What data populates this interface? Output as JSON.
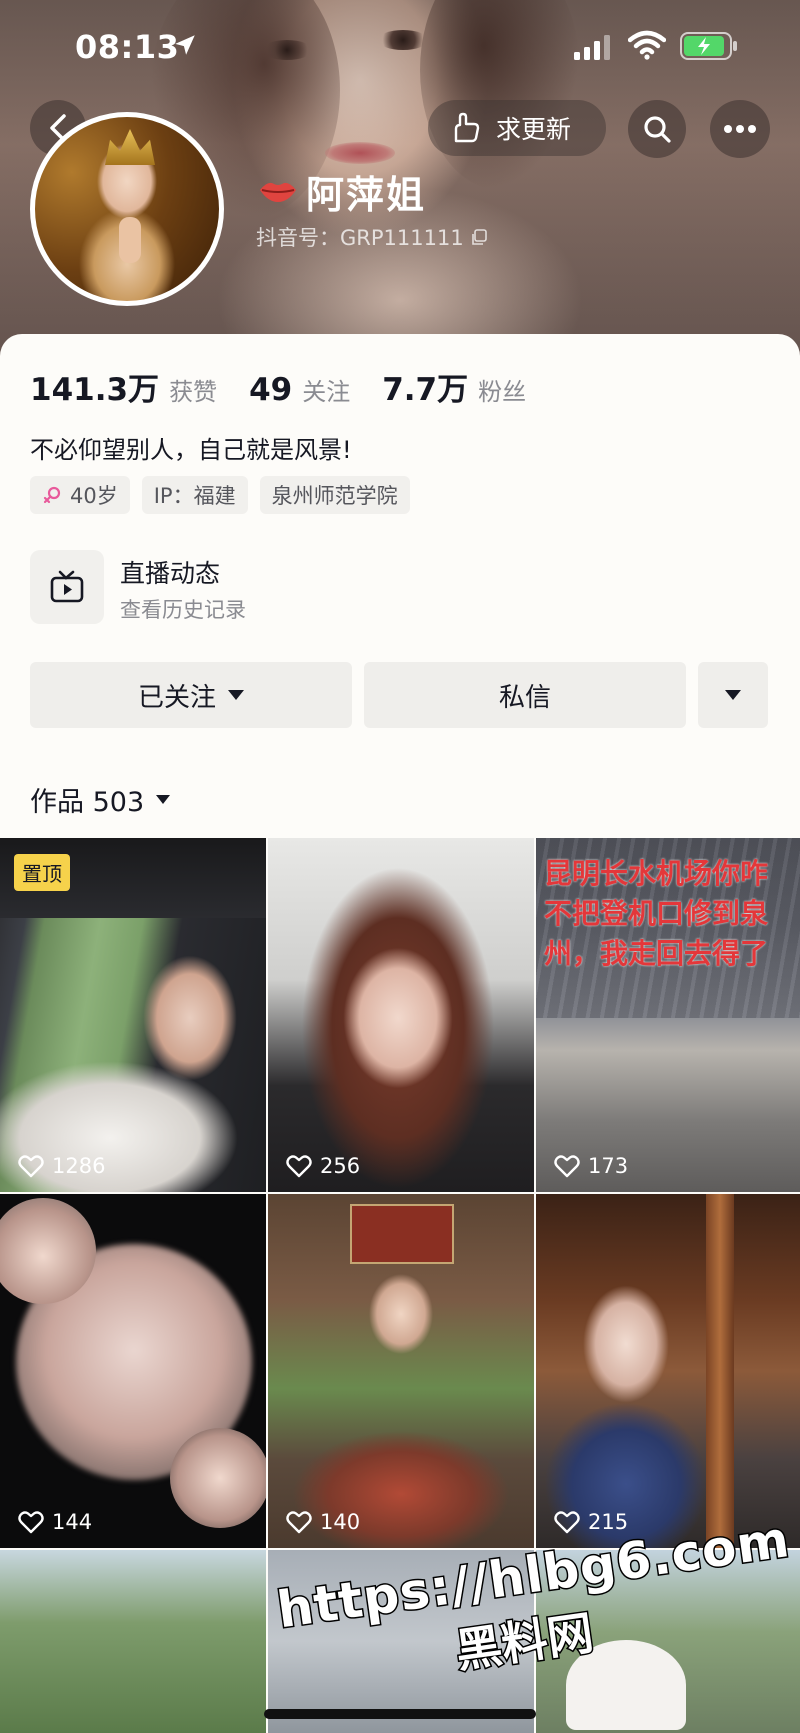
{
  "status": {
    "time": "08:13"
  },
  "header": {
    "refresh_label": "求更新",
    "name": "阿萍姐",
    "douyin_id": "抖音号：GRP111111"
  },
  "profile": {
    "stats": [
      {
        "num": "141.3万",
        "label": "获赞"
      },
      {
        "num": "49",
        "label": "关注"
      },
      {
        "num": "7.7万",
        "label": "粉丝"
      }
    ],
    "bio": "不必仰望别人，自己就是风景!",
    "tags": {
      "age": "40岁",
      "ip": "IP：福建",
      "school": "泉州师范学院"
    },
    "live": {
      "title": "直播动态",
      "subtitle": "查看历史记录"
    },
    "actions": {
      "follow": "已关注",
      "message": "私信"
    },
    "works_label": "作品 503"
  },
  "grid": {
    "pin_label": "置顶",
    "tile3_caption": "昆明长水机场你咋不把登机口修到泉州，我走回去得了",
    "likes": [
      "1286",
      "256",
      "173",
      "144",
      "140",
      "215"
    ]
  },
  "watermark": {
    "url": "https://hlbg6.com",
    "name": "黑料网"
  },
  "colors": {
    "text": "#161823",
    "secondary": "#8a8b91",
    "pin": "#f6d24b",
    "card_bg": "#fdfcf9"
  }
}
